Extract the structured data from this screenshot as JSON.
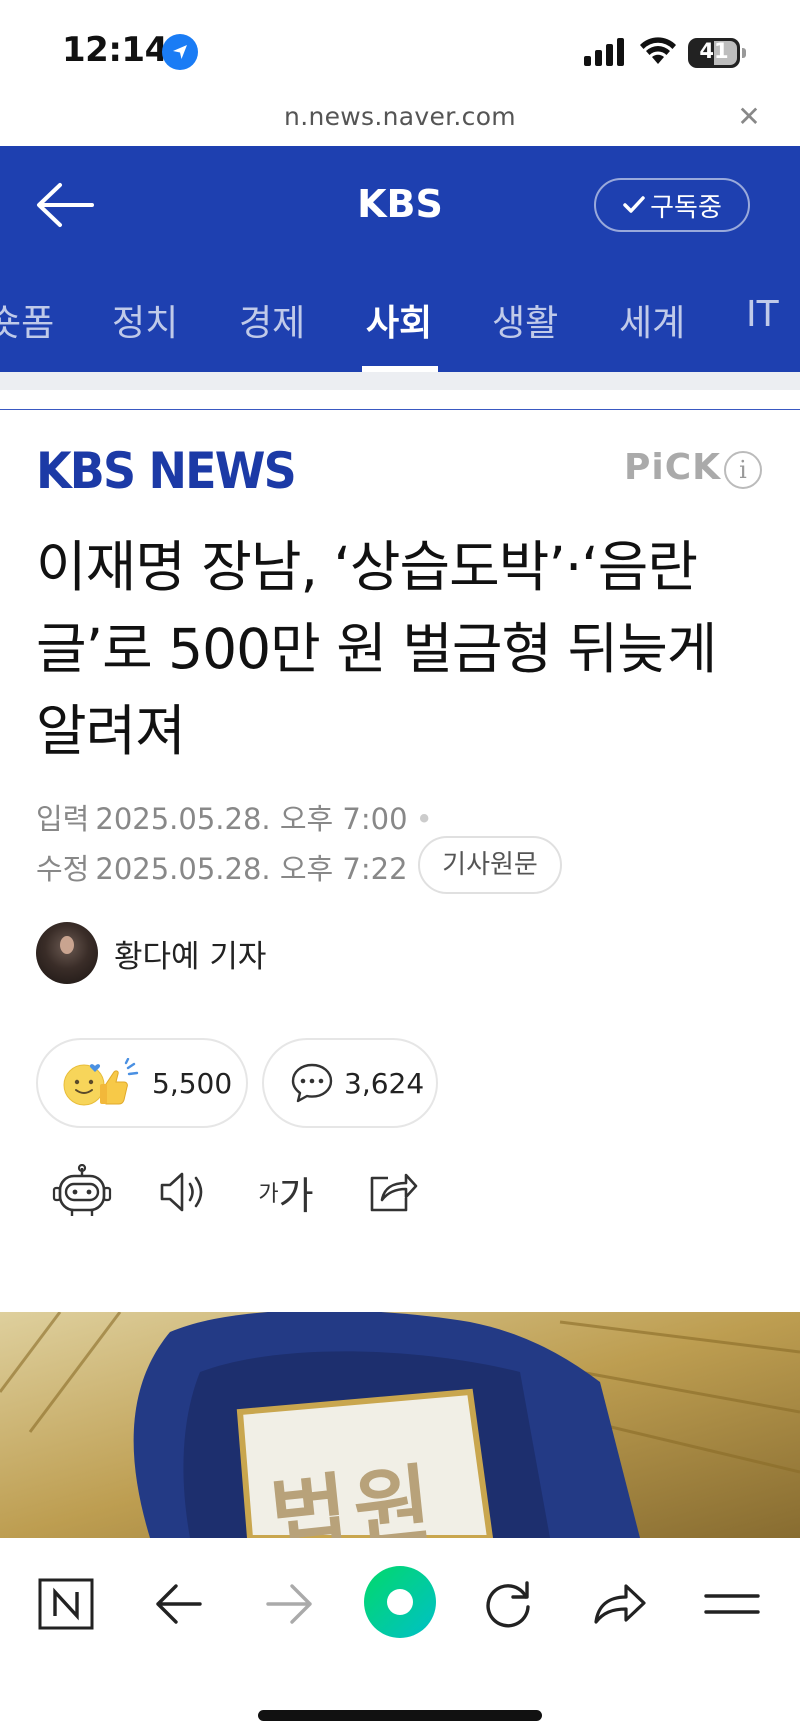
{
  "status_bar": {
    "time": "12:14",
    "battery": "41"
  },
  "url_bar": {
    "url": "n.news.naver.com"
  },
  "header": {
    "title": "KBS",
    "subscribe_label": "구독중"
  },
  "tabs": [
    {
      "label": "숏폼"
    },
    {
      "label": "정치"
    },
    {
      "label": "경제"
    },
    {
      "label": "사회",
      "active": true
    },
    {
      "label": "생활"
    },
    {
      "label": "세계"
    },
    {
      "label": "IT"
    }
  ],
  "article": {
    "press_logo": "KBS NEWS",
    "pick_label": "PiCK",
    "info_glyph": "i",
    "headline": "이재명 장남, ‘상습도박’·‘음란글’로 500만 원 벌금형 뒤늦게 알려져",
    "input_label": "입력",
    "input_time": "2025.05.28. 오후 7:00",
    "modified_label": "수정",
    "modified_time": "2025.05.28. 오후 7:22",
    "source_button": "기사원문",
    "author": "황다예 기자",
    "like_count": "5,500",
    "comment_count": "3,624",
    "font_size_small": "가",
    "font_size_large": "가"
  },
  "image": {
    "badge_text": "법원"
  },
  "colors": {
    "brand_blue": "#1e40b0",
    "logo_blue": "#1c3aa6",
    "naver_green": "#03c75a"
  }
}
